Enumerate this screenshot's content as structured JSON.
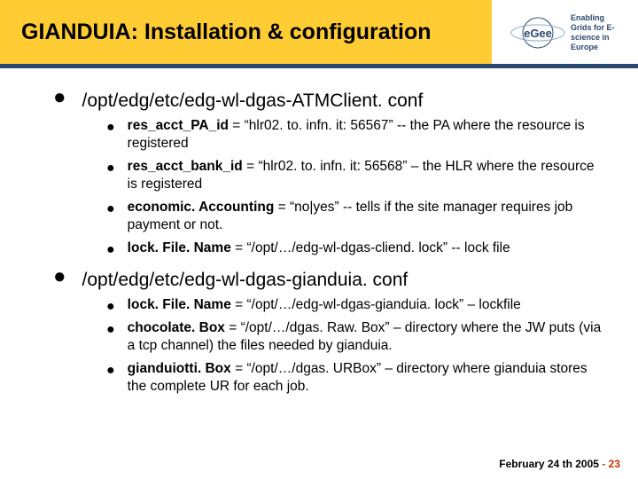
{
  "header": {
    "title": "GIANDUIA: Installation & configuration"
  },
  "logo": {
    "name": "EGEE",
    "tagline": "Enabling Grids for E-science in Europe"
  },
  "sections": [
    {
      "heading": "/opt/edg/etc/edg-wl-dgas-ATMClient. conf",
      "items": [
        {
          "key": "res_acct_PA_id",
          "rest": " = “hlr02. to. infn. it: 56567”  -- the PA where the resource is registered"
        },
        {
          "key": "res_acct_bank_id",
          "rest": " = “hlr02. to. infn. it: 56568” – the HLR where the resource is registered"
        },
        {
          "key": "economic. Accounting",
          "rest": " = “no|yes” -- tells if the site manager requires job payment or not."
        },
        {
          "key": "lock. File. Name",
          "rest": " = “/opt/…/edg-wl-dgas-cliend. lock” -- lock file"
        }
      ]
    },
    {
      "heading": "/opt/edg/etc/edg-wl-dgas-gianduia. conf",
      "items": [
        {
          "key": "lock. File. Name",
          "rest": " = “/opt/…/edg-wl-dgas-gianduia. lock” – lockfile"
        },
        {
          "key": "chocolate. Box",
          "rest": " = “/opt/…/dgas. Raw. Box” – directory where the JW puts (via a tcp channel) the files needed by gianduia."
        },
        {
          "key": "gianduiotti. Box",
          "rest": " = “/opt/…/dgas. URBox” – directory where gianduia stores the complete UR for each job."
        }
      ]
    }
  ],
  "footer": {
    "date": "February 24 th  2005",
    "separator": " - ",
    "page": "23"
  }
}
